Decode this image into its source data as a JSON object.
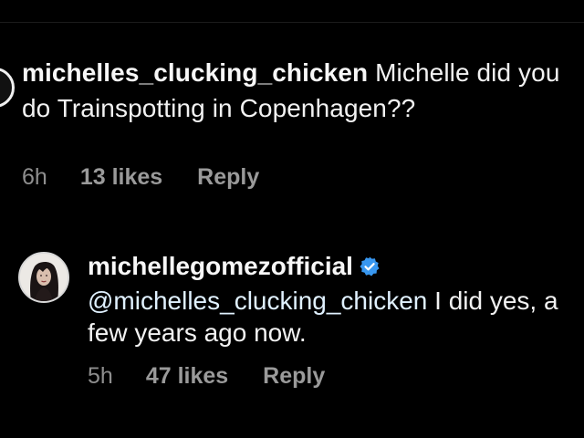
{
  "comments": [
    {
      "username": "michelles_clucking_chicken",
      "text": "Michelle did you do Trainspotting in Copenhagen??",
      "time": "6h",
      "likes": "13 likes",
      "reply": "Reply"
    },
    {
      "username": "michellegomezofficial",
      "verified": true,
      "mention": "@michelles_clucking_chicken",
      "text": "I did yes, a few years ago now.",
      "time": "5h",
      "likes": "47 likes",
      "reply": "Reply"
    }
  ],
  "colors": {
    "background": "#000000",
    "text": "#f5f5f5",
    "meta": "#9a9a9a",
    "verified": "#3897f0"
  },
  "icons": {
    "verified": "verified-badge-icon"
  }
}
